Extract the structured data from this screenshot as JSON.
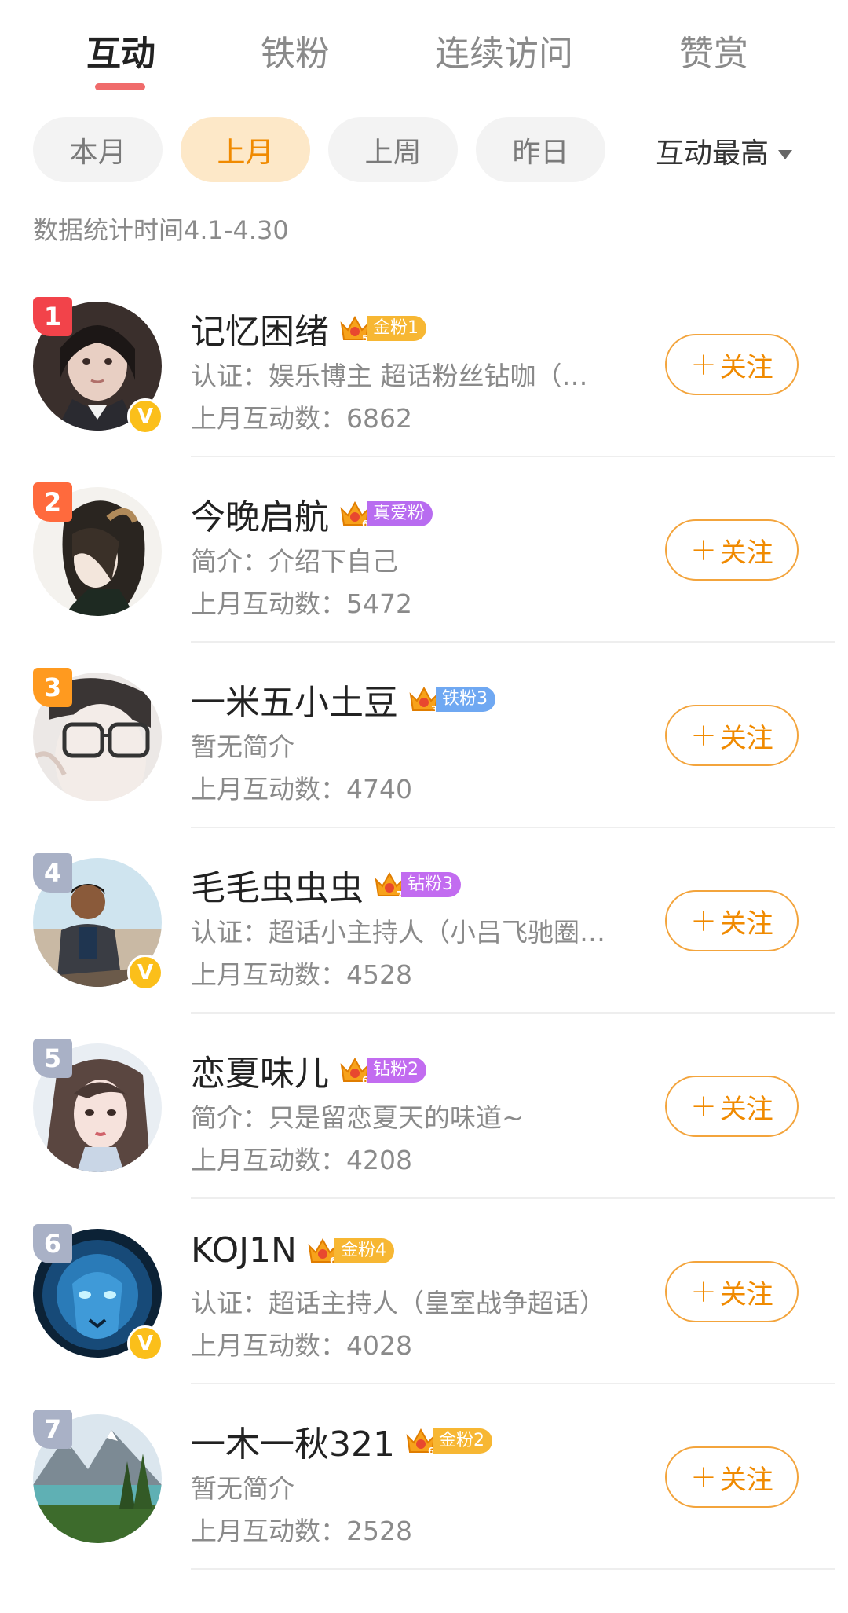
{
  "tabs": [
    {
      "label": "互动",
      "active": true
    },
    {
      "label": "铁粉",
      "active": false
    },
    {
      "label": "连续访问",
      "active": false
    },
    {
      "label": "赞赏",
      "active": false
    }
  ],
  "filters": [
    {
      "label": "本月",
      "active": false
    },
    {
      "label": "上月",
      "active": true
    },
    {
      "label": "上周",
      "active": false
    },
    {
      "label": "昨日",
      "active": false
    }
  ],
  "sort": {
    "label": "互动最高",
    "icon": "caret-down-icon"
  },
  "stat_period": "数据统计时间4.1-4.30",
  "follow_label": "关注",
  "colors": {
    "accent": "#f08a00",
    "tab_underline": "#f06b6b",
    "v_badge": "#fbbf1a"
  },
  "users": [
    {
      "rank": "1",
      "rank_color": "#f2434a",
      "name": "记忆困绪",
      "crown_level": "5",
      "badge": "金粉1",
      "badge_color": "#f7b733",
      "desc": "认证：娱乐博主 超话粉丝钻咖（…",
      "count": "上月互动数：6862",
      "verified": true,
      "avatar": "girl-photo"
    },
    {
      "rank": "2",
      "rank_color": "#ff6a3d",
      "name": "今晚启航",
      "crown_level": "6",
      "badge": "真爱粉",
      "badge_color": "#b86cf0",
      "desc": "简介：介绍下自己",
      "count": "上月互动数：5472",
      "verified": false,
      "avatar": "anime-girl"
    },
    {
      "rank": "3",
      "rank_color": "#ff9a1f",
      "name": "一米五小土豆",
      "crown_level": "3",
      "badge": "铁粉3",
      "badge_color": "#6fa8f2",
      "desc": "暂无简介",
      "count": "上月互动数：4740",
      "verified": false,
      "avatar": "glasses-sketch"
    },
    {
      "rank": "4",
      "rank_color": "#a9b1c6",
      "name": "毛毛虫虫虫",
      "crown_level": "7",
      "badge": "钻粉3",
      "badge_color": "#c26cf0",
      "desc": "认证：超话小主持人（小吕飞驰圈…",
      "count": "上月互动数：4528",
      "verified": true,
      "avatar": "man-photo"
    },
    {
      "rank": "5",
      "rank_color": "#a9b1c6",
      "name": "恋夏味儿",
      "crown_level": "6",
      "badge": "钻粉2",
      "badge_color": "#c26cf0",
      "desc": "简介：只是留恋夏天的味道~",
      "count": "上月互动数：4208",
      "verified": false,
      "avatar": "painted-girl"
    },
    {
      "rank": "6",
      "rank_color": "#a9b1c6",
      "name": "KOJ1N",
      "crown_level": "6",
      "badge": "金粉4",
      "badge_color": "#f7b733",
      "desc": "认证：超话主持人（皇室战争超话）",
      "count": "上月互动数：4028",
      "verified": true,
      "avatar": "blue-lion"
    },
    {
      "rank": "7",
      "rank_color": "#a9b1c6",
      "name": "一木一秋321",
      "crown_level": "6",
      "badge": "金粉2",
      "badge_color": "#f7b733",
      "desc": "暂无简介",
      "count": "上月互动数：2528",
      "verified": false,
      "avatar": "mountain-lake"
    }
  ]
}
